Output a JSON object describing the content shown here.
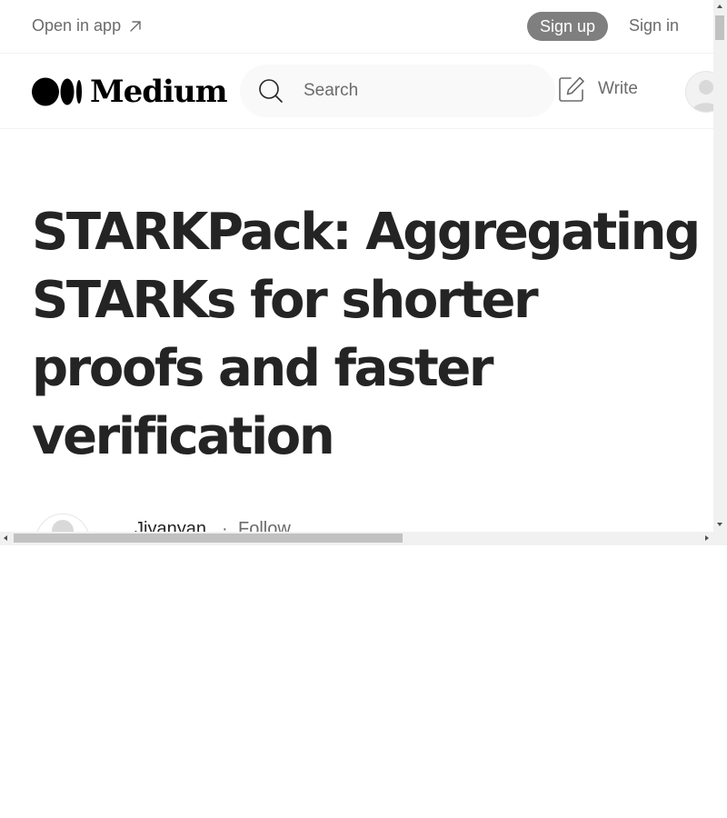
{
  "topbar": {
    "open_in_app_label": "Open in app",
    "signup_label": "Sign up",
    "signin_label": "Sign in"
  },
  "header": {
    "logo_text": "Medium",
    "search_placeholder": "Search",
    "write_label": "Write"
  },
  "article": {
    "title": "STARKPack: Aggregating STARKs for shorter proofs and faster verification",
    "author": "Jiyanyan",
    "separator": "·",
    "follow_label": "Follow"
  },
  "icons": {
    "open_in_app": "arrow-up-right-icon",
    "search": "search-icon",
    "write": "write-icon",
    "avatar": "user-avatar-icon"
  },
  "colors": {
    "signup_bg": "#7f7f7f",
    "text_primary": "#242424",
    "text_secondary": "#6b6b6b",
    "search_bg": "#f9f9f9"
  }
}
